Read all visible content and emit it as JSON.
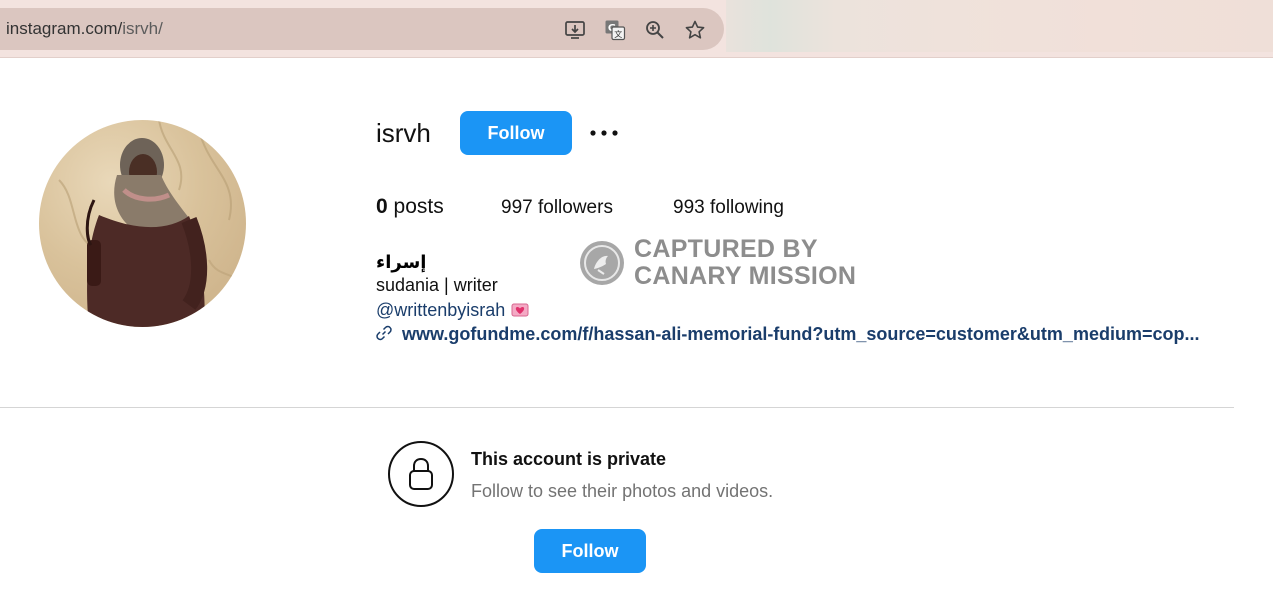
{
  "browser": {
    "url_host": "instagram.com/",
    "url_path": "isrvh/",
    "icons": [
      "install-app-icon",
      "translate-icon",
      "zoom-icon",
      "bookmark-star-icon"
    ]
  },
  "profile": {
    "username": "isrvh",
    "follow_label": "Follow",
    "more_icon": "more-options-icon",
    "stats": {
      "posts_count": "0",
      "posts_label": " posts",
      "followers_text": "997 followers",
      "following_text": "993 following"
    },
    "full_name": "إسراء",
    "bio": "sudania | writer",
    "threads_handle": "@writtenbyisrah",
    "threads_emoji": "heart-letter-emoji",
    "link_icon": "link-icon",
    "link_text": "www.gofundme.com/f/hassan-ali-memorial-fund?utm_source=customer&utm_medium=cop..."
  },
  "watermark": {
    "line1": "CAPTURED BY",
    "line2": "CANARY MISSION"
  },
  "private_section": {
    "lock_icon": "lock-icon",
    "title": "This account is private",
    "subtitle": "Follow to see their photos and videos.",
    "follow_label": "Follow"
  },
  "colors": {
    "follow_button": "#1b95f5",
    "link": "#1a3d6b",
    "chrome_bg": "#f3e3df",
    "urlbar_bg": "#dbc6c0",
    "watermark": "#8d8d8d"
  }
}
